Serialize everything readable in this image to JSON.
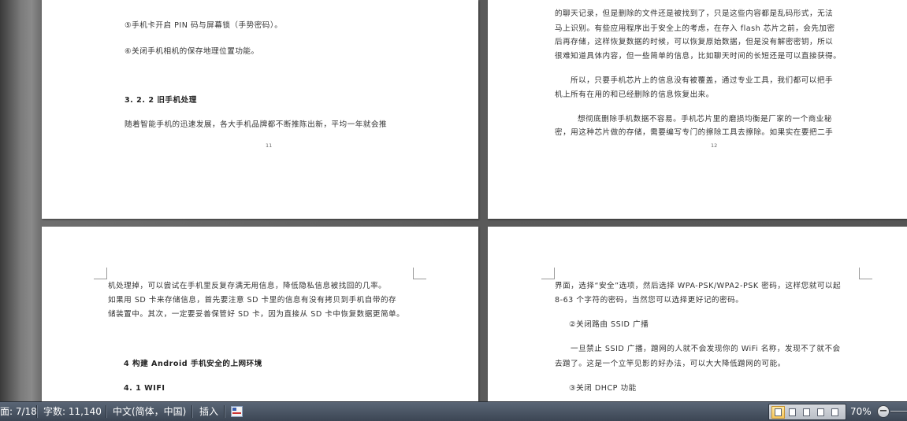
{
  "pages": {
    "top_left": {
      "lines": [
        "⑤手机卡开启 PIN 码与屏幕锁（手势密码）。",
        "⑥关闭手机相机的保存地理位置功能。",
        "3. 2. 2 旧手机处理",
        "随着智能手机的迅速发展，各大手机品牌都不断推陈出新，平均一年就会推"
      ],
      "page_number": "11"
    },
    "top_right": {
      "lines": [
        "的聊天记录，但是删除的文件还是被找到了，只是这些内容都是乱码形式，无法",
        "马上识别。有些应用程序出于安全上的考虑，在存入 flash 芯片之前，会先加密",
        "后再存储，这样恢复数据的时候，可以恢复原始数据，但是没有解密密钥，所以",
        "很难知道具体内容，但一些简单的信息，比如聊天时间的长短还是可以直接获得。",
        "所以，只要手机芯片上的信息没有被覆盖，通过专业工具，我们都可以把手",
        "机上所有在用的和已经删除的信息恢复出来。",
        "想彻底删除手机数据不容易。手机芯片里的磨损均衡是厂家的一个商业秘",
        "密，用这种芯片做的存储，需要编写专门的擦除工具去擦除。如果实在要把二手"
      ],
      "page_number": "12"
    },
    "bottom_left": {
      "lines": [
        "机处理掉，可以尝试在手机里反复存满无用信息，降低隐私信息被找回的几率。",
        "如果用 SD 卡来存储信息，首先要注意 SD 卡里的信息有没有拷贝到手机自带的存",
        "储装置中。其次，一定要妥善保管好 SD 卡，因为直接从 SD 卡中恢复数据更简单。",
        "4 构建 Android 手机安全的上网环境",
        "4. 1 WIFI"
      ]
    },
    "bottom_right": {
      "lines": [
        "界面，选择“安全”选项，然后选择 WPA-PSK/WPA2-PSK 密码，这样您就可以起",
        "8-63 个字符的密码，当然您可以选择更好记的密码。",
        "②关闭路由 SSID 广播",
        "一旦禁止 SSID 广播，蹭网的人就不会发现你的 WiFi 名称，发现不了就不会",
        "去蹭了。这是一个立竿见影的好办法，可以大大降低蹭网的可能。",
        "③关闭 DHCP 功能"
      ]
    }
  },
  "statusbar": {
    "page": "面: 7/18",
    "word_count": "字数: 11,140",
    "language": "中文(简体，中国)",
    "insert_mode": "插入",
    "zoom": "70%",
    "zoom_out_symbol": "−"
  },
  "colors": {
    "statusbar": "#4a5564",
    "page": "#ffffff",
    "active_view": "#f8c75b"
  },
  "icons": [
    "language-icon",
    "print-layout-icon",
    "full-screen-reading-icon",
    "web-layout-icon",
    "outline-icon",
    "draft-icon",
    "zoom-out-icon"
  ]
}
